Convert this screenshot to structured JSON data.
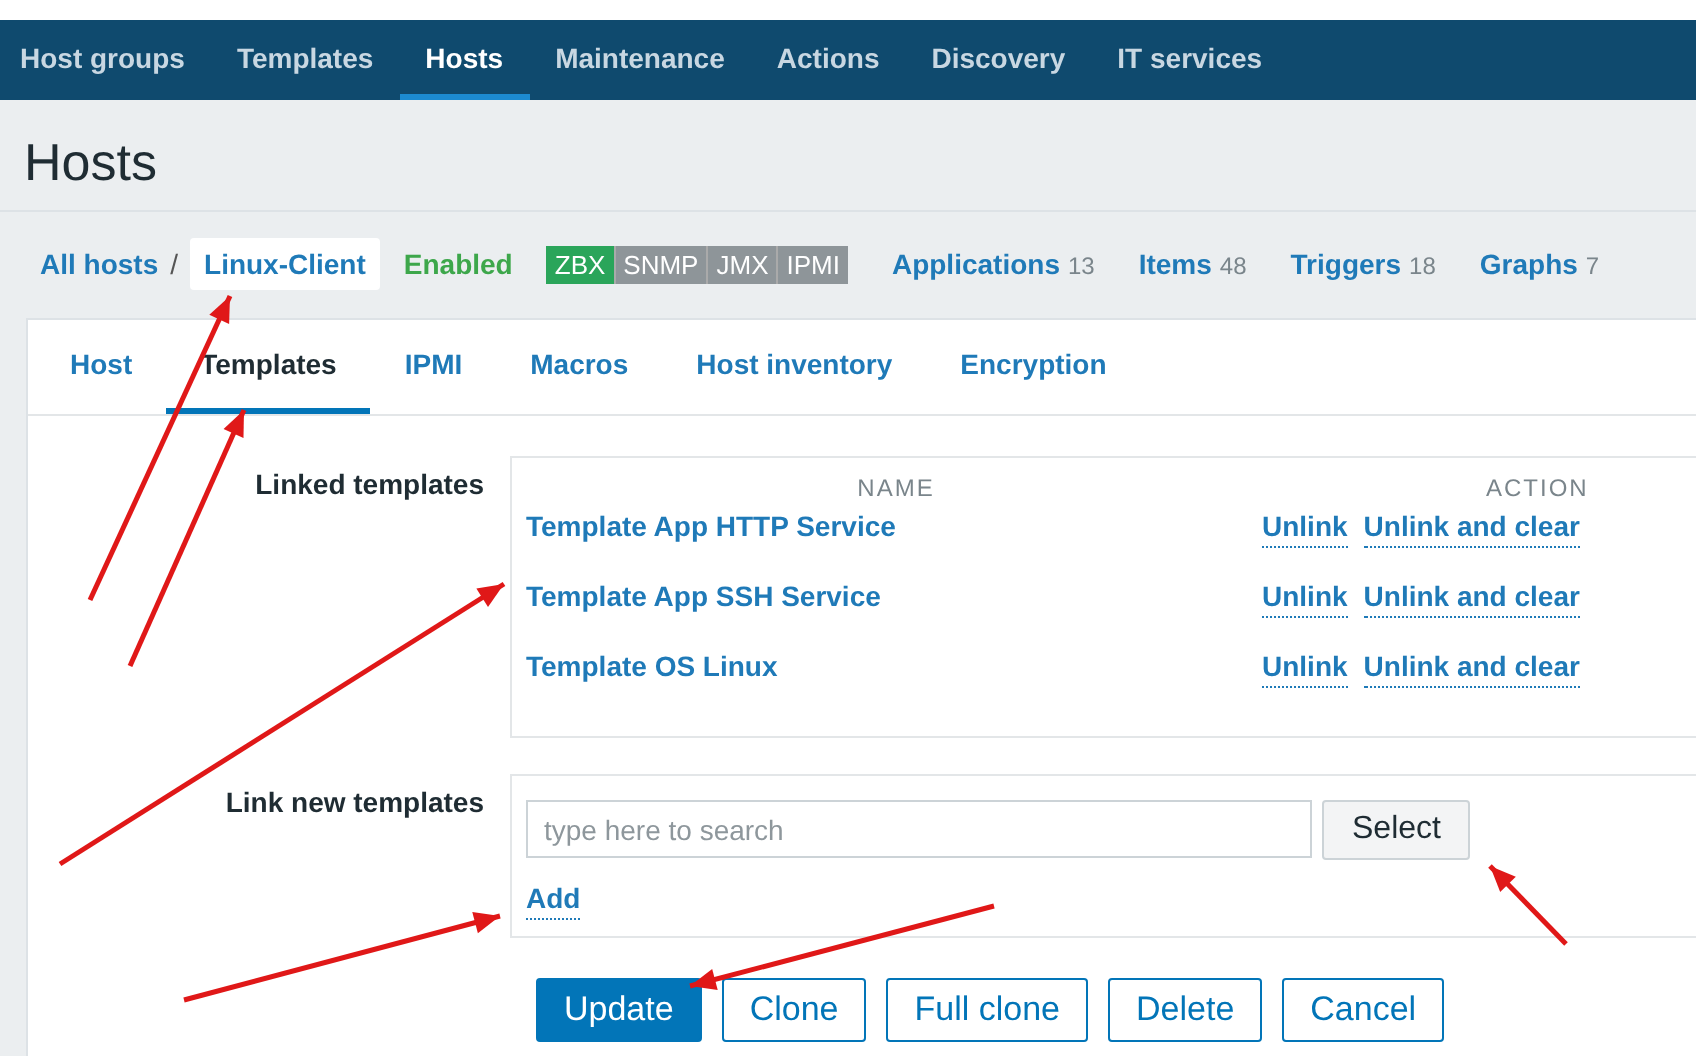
{
  "nav": [
    {
      "label": "Host groups",
      "selected": false
    },
    {
      "label": "Templates",
      "selected": false
    },
    {
      "label": "Hosts",
      "selected": true
    },
    {
      "label": "Maintenance",
      "selected": false
    },
    {
      "label": "Actions",
      "selected": false
    },
    {
      "label": "Discovery",
      "selected": false
    },
    {
      "label": "IT services",
      "selected": false
    }
  ],
  "title": "Hosts",
  "breadcrumb": {
    "all": "All hosts",
    "separator": "/",
    "current": "Linux-Client"
  },
  "status": "Enabled",
  "availability": [
    {
      "label": "ZBX",
      "on": true
    },
    {
      "label": "SNMP",
      "on": false
    },
    {
      "label": "JMX",
      "on": false
    },
    {
      "label": "IPMI",
      "on": false
    }
  ],
  "links": [
    {
      "label": "Applications",
      "count": "13"
    },
    {
      "label": "Items",
      "count": "48"
    },
    {
      "label": "Triggers",
      "count": "18"
    },
    {
      "label": "Graphs",
      "count": "7"
    }
  ],
  "tabs": [
    {
      "label": "Host",
      "selected": false
    },
    {
      "label": "Templates",
      "selected": true
    },
    {
      "label": "IPMI",
      "selected": false
    },
    {
      "label": "Macros",
      "selected": false
    },
    {
      "label": "Host inventory",
      "selected": false
    },
    {
      "label": "Encryption",
      "selected": false
    }
  ],
  "linked": {
    "label": "Linked templates",
    "columns": [
      "NAME",
      "ACTION"
    ],
    "rows": [
      {
        "name": "Template App HTTP Service",
        "unlink": "Unlink",
        "unlink_clear": "Unlink and clear"
      },
      {
        "name": "Template App SSH Service",
        "unlink": "Unlink",
        "unlink_clear": "Unlink and clear"
      },
      {
        "name": "Template OS Linux",
        "unlink": "Unlink",
        "unlink_clear": "Unlink and clear"
      }
    ]
  },
  "link_new": {
    "label": "Link new templates",
    "placeholder": "type here to search",
    "select": "Select",
    "add": "Add"
  },
  "buttons": [
    {
      "label": "Update",
      "primary": true
    },
    {
      "label": "Clone",
      "primary": false
    },
    {
      "label": "Full clone",
      "primary": false
    },
    {
      "label": "Delete",
      "primary": false
    },
    {
      "label": "Cancel",
      "primary": false
    }
  ]
}
